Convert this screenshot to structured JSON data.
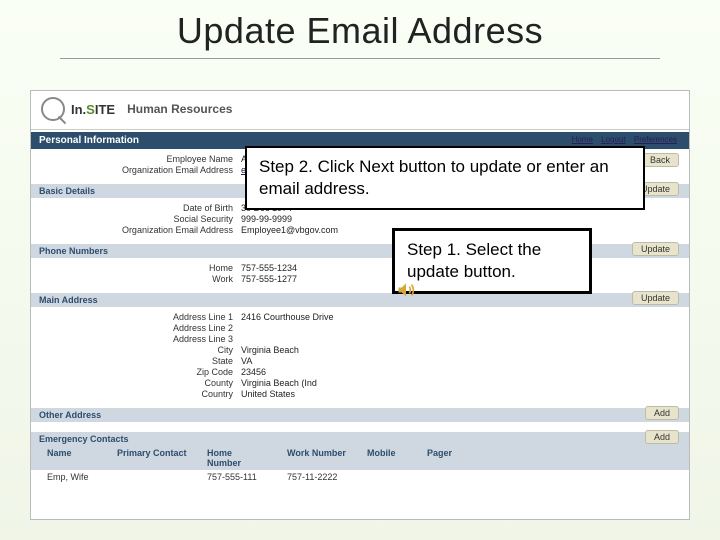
{
  "slide": {
    "title": "Update Email Address"
  },
  "callouts": {
    "step2": "Step 2. Click Next button to update or enter an email address.",
    "step1": "Step 1. Select the update button."
  },
  "app": {
    "logo_prefix": "In.",
    "logo_green": "S",
    "logo_suffix": "ITE",
    "subtitle": "Human Resources",
    "top_links": {
      "l1": "Home",
      "l2": "Logout",
      "l3": "Preferences"
    }
  },
  "sections": {
    "personal_info": "Personal Information",
    "basic_details": "Basic Details",
    "phone_numbers": "Phone Numbers",
    "main_address": "Main Address",
    "other_address": "Other Address",
    "emergency_contacts": "Emergency Contacts"
  },
  "buttons": {
    "back": "Back",
    "update_basic": "Update",
    "update_phone": "Update",
    "update_addr": "Update",
    "add_other": "Add",
    "add_contact": "Add"
  },
  "fields": {
    "emp_name_label": "Employee Name",
    "emp_name_value": "A Employee",
    "org_email_label": "Organization Email Address",
    "org_email_value": "employee@...",
    "dob_label": "Date of Birth",
    "dob_value": "30 Dec 1974",
    "ssn_label": "Social Security",
    "ssn_value": "999-99-9999",
    "org_email2_label": "Organization Email Address",
    "org_email2_value": "Employee1@vbgov.com",
    "addr1_label": "Address Line 1",
    "addr1_value": "2416 Courthouse Drive",
    "addr2_label": "Address Line 2",
    "addr2_value": "",
    "addr3_label": "Address Line 3",
    "addr3_value": "",
    "city_label": "City",
    "city_value": "Virginia Beach",
    "state_label": "State",
    "state_value": "VA",
    "zip_label": "Zip Code",
    "zip_value": "23456",
    "county_label": "County",
    "county_value": "Virginia Beach (Ind",
    "country_label": "Country",
    "country_value": "United States"
  },
  "phone_table": {
    "h1": "",
    "h2": "Home",
    "h3": "Work",
    "v1": "",
    "v2": "757-555-1234",
    "v3": "757-555-1277"
  },
  "emerg_table": {
    "h1": "Name",
    "h2": "Primary Contact",
    "h3": "Home Number",
    "h4": "Work Number",
    "h5": "Mobile",
    "h6": "Pager",
    "r1c1": "Emp, Wife",
    "r1c3": "757-555-111",
    "r1c4": "757-11-2222"
  }
}
